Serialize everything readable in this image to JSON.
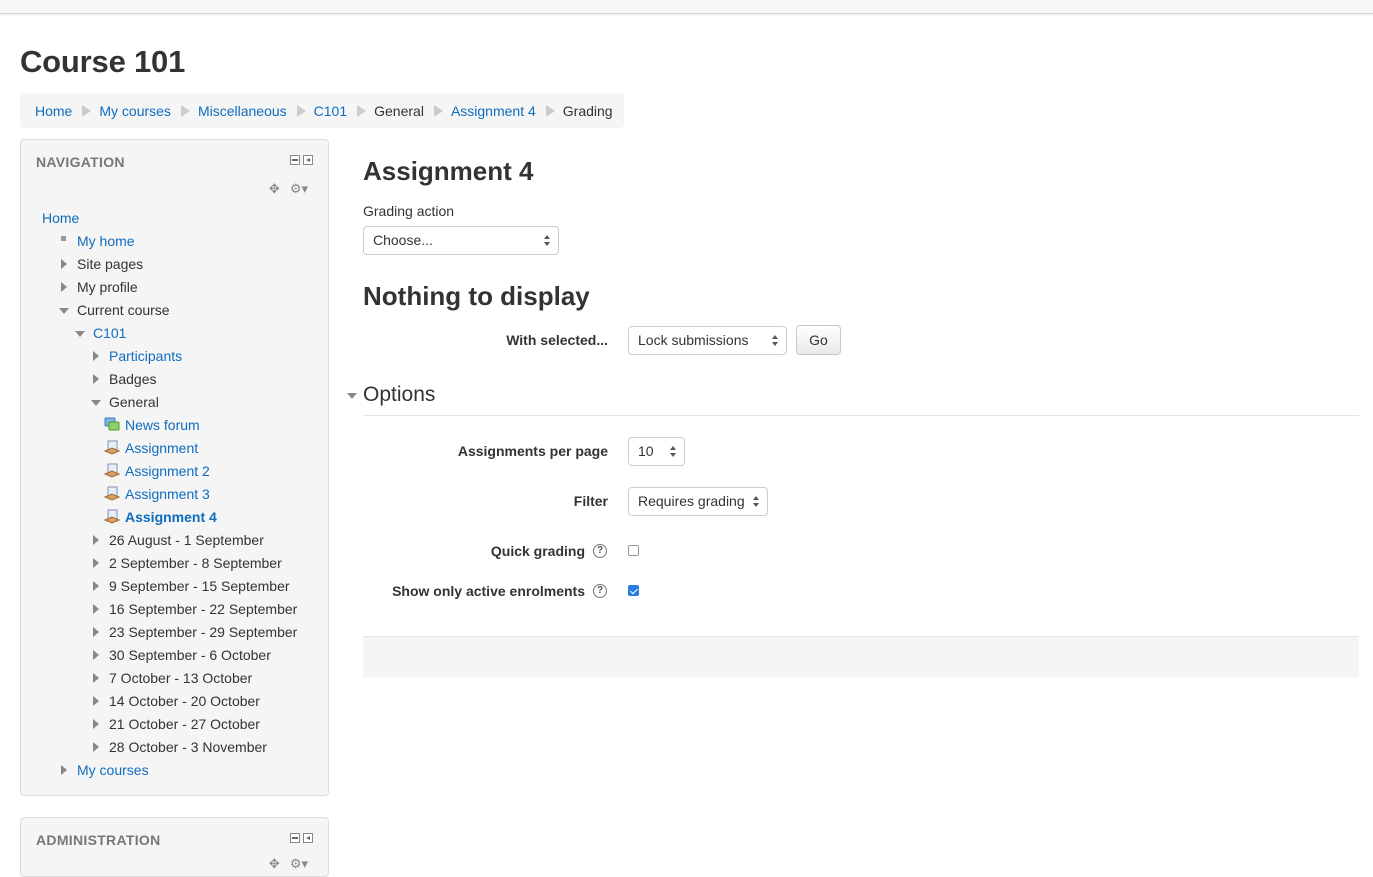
{
  "page_title": "Course 101",
  "breadcrumb": [
    {
      "label": "Home",
      "link": true
    },
    {
      "label": "My courses",
      "link": true
    },
    {
      "label": "Miscellaneous",
      "link": true
    },
    {
      "label": "C101",
      "link": true
    },
    {
      "label": "General",
      "link": false
    },
    {
      "label": "Assignment 4",
      "link": true
    },
    {
      "label": "Grading",
      "link": false
    }
  ],
  "navigation": {
    "title": "NAVIGATION",
    "tree": [
      {
        "label": "Home",
        "level": 0,
        "marker": "none",
        "link": true
      },
      {
        "label": "My home",
        "level": 1,
        "marker": "bullet",
        "link": true
      },
      {
        "label": "Site pages",
        "level": 1,
        "marker": "collapsed",
        "link": false
      },
      {
        "label": "My profile",
        "level": 1,
        "marker": "collapsed",
        "link": false
      },
      {
        "label": "Current course",
        "level": 1,
        "marker": "expanded",
        "link": false
      },
      {
        "label": "C101",
        "level": 2,
        "marker": "expanded",
        "link": true
      },
      {
        "label": "Participants",
        "level": 3,
        "marker": "collapsed",
        "link": true
      },
      {
        "label": "Badges",
        "level": 3,
        "marker": "collapsed",
        "link": false
      },
      {
        "label": "General",
        "level": 3,
        "marker": "expanded",
        "link": false
      },
      {
        "label": "News forum",
        "level": 4,
        "marker": "forum",
        "link": true
      },
      {
        "label": "Assignment",
        "level": 4,
        "marker": "assign",
        "link": true
      },
      {
        "label": "Assignment 2",
        "level": 4,
        "marker": "assign",
        "link": true
      },
      {
        "label": "Assignment 3",
        "level": 4,
        "marker": "assign",
        "link": true
      },
      {
        "label": "Assignment 4",
        "level": 4,
        "marker": "assign",
        "link": true,
        "active": true
      },
      {
        "label": "26 August - 1 September",
        "level": 3,
        "marker": "collapsed",
        "link": false
      },
      {
        "label": "2 September - 8 September",
        "level": 3,
        "marker": "collapsed",
        "link": false
      },
      {
        "label": "9 September - 15 September",
        "level": 3,
        "marker": "collapsed",
        "link": false
      },
      {
        "label": "16 September - 22 September",
        "level": 3,
        "marker": "collapsed",
        "link": false
      },
      {
        "label": "23 September - 29 September",
        "level": 3,
        "marker": "collapsed",
        "link": false
      },
      {
        "label": "30 September - 6 October",
        "level": 3,
        "marker": "collapsed",
        "link": false
      },
      {
        "label": "7 October - 13 October",
        "level": 3,
        "marker": "collapsed",
        "link": false
      },
      {
        "label": "14 October - 20 October",
        "level": 3,
        "marker": "collapsed",
        "link": false
      },
      {
        "label": "21 October - 27 October",
        "level": 3,
        "marker": "collapsed",
        "link": false
      },
      {
        "label": "28 October - 3 November",
        "level": 3,
        "marker": "collapsed",
        "link": false
      },
      {
        "label": "My courses",
        "level": 1,
        "marker": "collapsed",
        "link": true
      }
    ]
  },
  "administration": {
    "title": "ADMINISTRATION"
  },
  "main": {
    "heading": "Assignment 4",
    "grading_action_label": "Grading action",
    "grading_action_value": "Choose...",
    "nothing_heading": "Nothing to display",
    "with_selected_label": "With selected...",
    "with_selected_value": "Lock submissions",
    "go_label": "Go",
    "options_legend": "Options",
    "per_page_label": "Assignments per page",
    "per_page_value": "10",
    "filter_label": "Filter",
    "filter_value": "Requires grading",
    "quick_grading_label": "Quick grading",
    "quick_grading_checked": false,
    "active_enrolments_label": "Show only active enrolments",
    "active_enrolments_checked": true,
    "help_glyph": "?"
  },
  "colors": {
    "link": "#0f6cbf",
    "checkbox_checked": "#2a7be4"
  },
  "icons": [
    "minus-icon",
    "dock-icon",
    "move-icon",
    "gear-icon",
    "forum-icon",
    "assignment-icon",
    "help-icon"
  ]
}
